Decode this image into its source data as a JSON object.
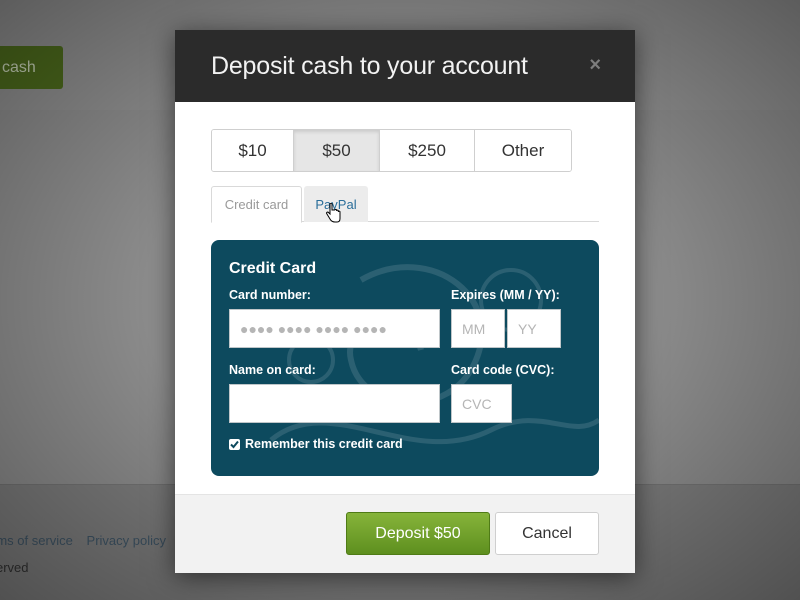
{
  "background": {
    "cash_button_label": "cash",
    "footer_links": [
      "rms of service",
      "Privacy policy"
    ],
    "rights_text": "erved"
  },
  "modal": {
    "title": "Deposit cash to your account",
    "close_symbol": "×",
    "amounts": [
      {
        "label": "$10",
        "selected": false
      },
      {
        "label": "$50",
        "selected": true
      },
      {
        "label": "$250",
        "selected": false
      },
      {
        "label": "Other",
        "selected": false
      }
    ],
    "tabs": [
      {
        "label": "Credit card",
        "active": true
      },
      {
        "label": "PayPal",
        "active": false
      }
    ],
    "card_form": {
      "title": "Credit Card",
      "card_number_label": "Card number:",
      "card_number_placeholder": "●●●● ●●●● ●●●● ●●●●",
      "expires_label": "Expires (MM / YY):",
      "mm_placeholder": "MM",
      "yy_placeholder": "YY",
      "name_label": "Name on card:",
      "name_value": "",
      "cvc_label": "Card code (CVC):",
      "cvc_placeholder": "CVC",
      "remember_label": "Remember this credit card",
      "remember_checked": true
    },
    "footer": {
      "deposit_label": "Deposit $50",
      "cancel_label": "Cancel"
    }
  },
  "colors": {
    "header_bg": "#2b2b2b",
    "card_panel_bg": "#0d4a5e",
    "deposit_button": "#6fa02a",
    "link_blue": "#2a6e9a"
  },
  "icons": {
    "close": "close-icon",
    "cursor": "hand-pointer-icon",
    "checkbox": "checkmark-icon"
  }
}
